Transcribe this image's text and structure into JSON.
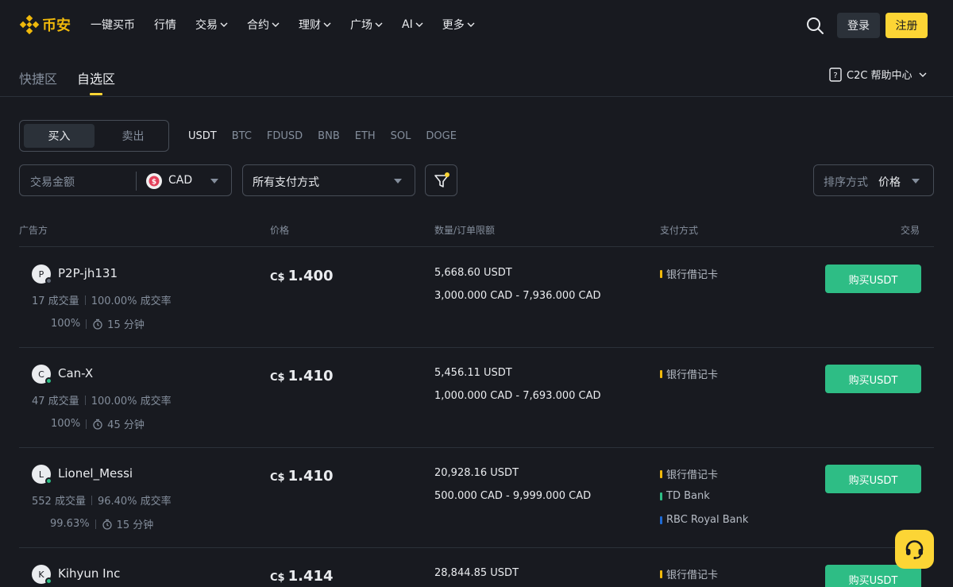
{
  "nav": {
    "logo_text": "币安",
    "links": [
      {
        "label": "一键买币",
        "dropdown": false
      },
      {
        "label": "行情",
        "dropdown": false
      },
      {
        "label": "交易",
        "dropdown": true
      },
      {
        "label": "合约",
        "dropdown": true
      },
      {
        "label": "理财",
        "dropdown": true
      },
      {
        "label": "广场",
        "dropdown": true
      },
      {
        "label": "AI",
        "dropdown": true
      },
      {
        "label": "更多",
        "dropdown": true
      }
    ],
    "login_label": "登录",
    "register_label": "注册"
  },
  "subtabs": {
    "quick": "快捷区",
    "self": "自选区",
    "help_center": "C2C 帮助中心"
  },
  "toggle": {
    "buy": "买入",
    "sell": "卖出"
  },
  "coins": [
    "USDT",
    "BTC",
    "FDUSD",
    "BNB",
    "ETH",
    "SOL",
    "DOGE"
  ],
  "active_coin": "USDT",
  "filters": {
    "amount_placeholder": "交易金额",
    "currency": "CAD",
    "payment": "所有支付方式",
    "sort_label": "排序方式",
    "sort_value": "价格"
  },
  "table": {
    "headers": {
      "advertiser": "广告方",
      "price": "价格",
      "quantity": "数量/订单限额",
      "payment": "支付方式",
      "trade": "交易"
    },
    "rows": [
      {
        "initial": "P",
        "name": "P2P-jh131",
        "online": false,
        "orders": "17 成交量",
        "rate": "100.00% 成交率",
        "positive": "100%",
        "time": "15 分钟",
        "currency": "C$",
        "price": "1.400",
        "quantity": "5,668.60 USDT",
        "limit": "3,000.000 CAD - 7,936.000 CAD",
        "payments": [
          {
            "name": "银行借记卡",
            "color": "#f0b90b"
          }
        ],
        "button": "购买USDT"
      },
      {
        "initial": "C",
        "name": "Can-X",
        "online": true,
        "orders": "47 成交量",
        "rate": "100.00% 成交率",
        "positive": "100%",
        "time": "45 分钟",
        "currency": "C$",
        "price": "1.410",
        "quantity": "5,456.11 USDT",
        "limit": "1,000.000 CAD - 7,693.000 CAD",
        "payments": [
          {
            "name": "银行借记卡",
            "color": "#f0b90b"
          }
        ],
        "button": "购买USDT"
      },
      {
        "initial": "L",
        "name": "Lionel_Messi",
        "online": true,
        "orders": "552 成交量",
        "rate": "96.40% 成交率",
        "positive": "99.63%",
        "time": "15 分钟",
        "currency": "C$",
        "price": "1.410",
        "quantity": "20,928.16 USDT",
        "limit": "500.000 CAD - 9,999.000 CAD",
        "payments": [
          {
            "name": "银行借记卡",
            "color": "#f0b90b"
          },
          {
            "name": "TD Bank",
            "color": "#2ebd85"
          },
          {
            "name": "RBC Royal Bank",
            "color": "#1e6ad4"
          }
        ],
        "button": "购买USDT"
      },
      {
        "initial": "K",
        "name": "Kihyun Inc",
        "online": true,
        "orders": "",
        "rate": "",
        "positive": "",
        "time": "",
        "currency": "C$",
        "price": "1.414",
        "quantity": "28,844.85 USDT",
        "limit": "",
        "payments": [
          {
            "name": "银行借记卡",
            "color": "#f0b90b"
          }
        ],
        "button": "购买USDT"
      }
    ]
  },
  "colors": {
    "background": "#181a20",
    "brand_yellow": "#fcd535",
    "buy_green": "#2ebd85",
    "muted_text": "#848e9c",
    "border": "#474d57"
  }
}
